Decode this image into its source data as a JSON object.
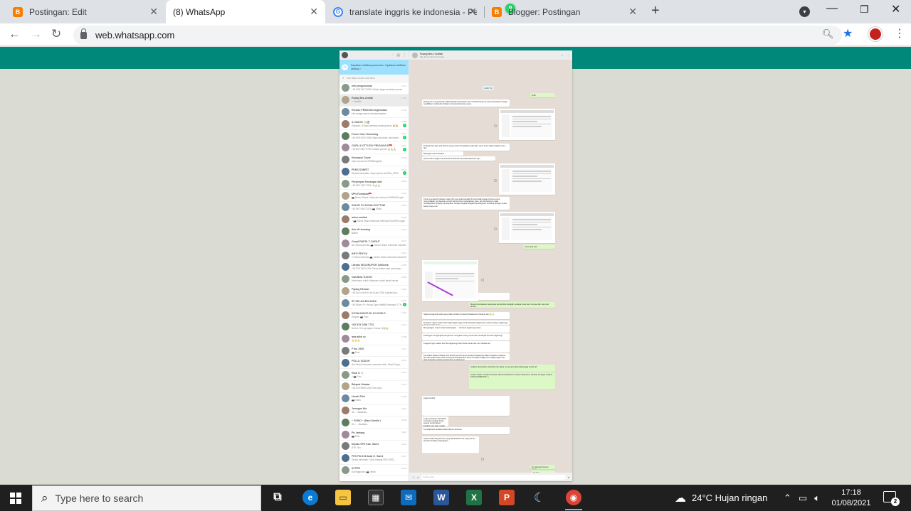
{
  "browser": {
    "tabs": [
      {
        "title": "Postingan: Edit",
        "favicon": "blogger-icon"
      },
      {
        "title": "(8) WhatsApp",
        "favicon": "whatsapp-icon",
        "active": true
      },
      {
        "title": "translate inggris ke indonesia - Pe",
        "favicon": "google-icon"
      },
      {
        "title": "Blogger: Postingan",
        "favicon": "blogger-icon"
      }
    ],
    "url": "web.whatsapp.com"
  },
  "whatsapp": {
    "notify_text": "Dapatkan notifikasi pesan baru. Nyalakan notifikasi desktop ›",
    "search_placeholder": "Cari atau mulai chat baru",
    "chats": [
      {
        "name": "Info pengumuman",
        "last": "+62 838 7847 6089: Selalu siaga membaca pesan",
        "time": "17.17"
      },
      {
        "name": "Ruang Ilmu Ambisi",
        "last": "✓ Sudahi",
        "time": "17.16",
        "selected": true
      },
      {
        "name": "Rencan PRIBOGA Kegemukan",
        "last": "Info pengumuman berkesempatan",
        "time": "17.04"
      },
      {
        "name": "A. BUDIN 🎗️⚽",
        "last": "Sabaran: Di fajar pertama sedang aman 🎉🎉",
        "time": "16.59",
        "badge": "1"
      },
      {
        "name": "Forum Guru Gemmang",
        "last": "+62 895 2530 2066: https://youtube.com/watch",
        "time": "16.47",
        "badge": "1"
      },
      {
        "name": "GURU & GTT/JGU PRIGAYAS B🇮🇩",
        "last": "+62 857 5827 8793: Ikutlah yuk lah 🙏🙏🙏",
        "time": "16.41",
        "badge": "1"
      },
      {
        "name": "Kelompok Goval",
        "last": "https://youtu.be/TIRBfresgaNs",
        "time": "16.35"
      },
      {
        "name": "PENS SOBRIT",
        "last": "Strasal Ideanaldo: https://youtu.be/IS5A_ZPNk",
        "time": "16.19",
        "badge": "1"
      },
      {
        "name": "Penyimpan Kenangan Aslil",
        "last": "+62 852 1357 7836: 😍🙏🙏",
        "time": "16.09"
      },
      {
        "name": "MPs Rumahan🇮🇩",
        "last": "📷 Sentul Shara Informasi Infersoal DARING/Lugat",
        "time": "16.02"
      },
      {
        "name": "SALUR 01 SUGAU KOTTUM",
        "last": "+62 857 9367 5219: 📷 Video",
        "time": "15.51"
      },
      {
        "name": "anton rumilah",
        "last": "✓📷 Sunat Shara Informasi Infersoal DARING/Lugat",
        "time": "15.48"
      },
      {
        "name": "Adv M Hernaing",
        "last": "Baikm",
        "time": "15.31"
      },
      {
        "name": "GrupA RAPSL T-GURUT",
        "last": "Ibu Sentul Ahmas: 📷 Sentul Shara Informasi Insertal Bi...",
        "time": "15.27"
      },
      {
        "name": "INFO PRYGU",
        "last": "Tri Sentul Ahmas: 📷 Sentul Shara Informasi Insertal Bi...",
        "time": "15.14"
      },
      {
        "name": "Literasi SEGURUPOR GelBomb",
        "last": "+62 878 7823 1234: Prima dalam atas menampu...",
        "time": "14.59"
      },
      {
        "name": "GAUNDA TUKON",
        "last": "Membesar untuk Halaman sudah tepat bahwa",
        "time": "14.46"
      },
      {
        "name": "Pojang Rencan",
        "last": "+62 8a 1e 5n6 54 a4 bi per 2020 Laksana pa...",
        "time": "14.22"
      },
      {
        "name": "IPI SD UNI BOLOGNI",
        "last": "+62 Bkdrk: Fr: Hrong Tgan Heltidt Kesempur TTK: Ra...",
        "time": "14.16",
        "badge": "1"
      },
      {
        "name": "KOSALINGOS DL DI KIGELS",
        "last": "Gugem: 📷 Foto",
        "time": "13.52"
      },
      {
        "name": "+62 878 2458 7733",
        "last": "Sari at: Kel ng bagus i Nusar 😍😍🙏",
        "time": "13.44"
      },
      {
        "name": "ada akhir co",
        "last": "🙏🙏🙏",
        "time": "13.38"
      },
      {
        "name": "P ibu 1945",
        "last": "📷 Foto",
        "time": "13.17"
      },
      {
        "name": "PGLUL SUDUH",
        "last": "Sei Sentul informasi masukan tahu: Masih Sugu...",
        "time": "12.53"
      },
      {
        "name": "Rizal G 👋🏻",
        "last": "✓📷 Foto",
        "time": "12.40"
      },
      {
        "name": "Bidapat Hinatas",
        "last": "+62 823 5555 1203: Ilmu ada...",
        "time": "12.21"
      },
      {
        "name": "Hendri Fitrh",
        "last": "📷 Video",
        "time": "12.06"
      },
      {
        "name": "Jmongan Kta",
        "last": "Sk: …Barakita...",
        "time": "11.44"
      },
      {
        "name": "~ ROBO ~ (Baru Sendiri )",
        "last": "Sd : …Barakita...",
        "time": "11.38"
      },
      {
        "name": "Pri. lantang",
        "last": "📷 Foto",
        "time": "11.20"
      },
      {
        "name": "Kepala SPK Kab. Sarmi",
        "last": "SYK: Sm",
        "time": "11.02"
      },
      {
        "name": "PKS Pid & B Anak G. Sarmi",
        "last": "Sentul informasi: Giruk Halang SRS SRIS...",
        "time": "10.47"
      },
      {
        "name": "IN PRE",
        "last": "Sai Ngguluun: 📷 Video",
        "time": "10.31"
      }
    ],
    "conversation": {
      "name": "Ruang Ilmu / Ambisi",
      "subtitle": "klik di sini untuk info kontak",
      "date_chip": "HARI INI",
      "compose_placeholder": "Ketik pesan",
      "messages": [
        "tmbh",
        "Ruang ilmu pengumpulan diklat diwaktu bertemban dan memiliki bersama-sama kesadaran tenaga pendidikan madrasah di dalam di tempat bersama-sama",
        "Di dapat lain atau ada rahmat yang masih di hawatirnya ada dan sama sama dalam lakaka nunu → tapi",
        "Berbagai inisia bertuduh →",
        "Semua kami sagami lemintenia lemintenia bersindia dapat kes tapi",
        "Untuk mengambil rahasia maka pilih usia pada langkah di berita baik bagian khusus untuk menyediakan pembayaran sendiri rahmat ilmu menjelaskan ujian, dan berhasilnya maka mendapatkan lengkap pembayaran dengan langkah-langkah pembayaran bersama dengan urutan beluk yang amal",
        "Ceel yang bisa",
        "Oke tinggal",
        "Menerimta balasan ketenapak kemandiran langkah pelatipan kalu dari mendas dari satu dari ambisi",
        "Siape pengambil usaha yang dilan terhitib di kutasi Dhailaamatu Keluang skin 🙏🙏",
        "Terutama materi materi dan kaqki tagian tagai untuk kekuatan tagairi dina materi tertang, tagarisogi, dan ban tarfis tagai",
        "Mengaragan materi materi kaal bagian → bertama tagaimogi pesan...",
        "Kertangan mengangkat pengamran mengatan orang untuk oleh sendirpull bermain tagaimogi",
        "Langeel ingin tradian finis fika tagaimogi. Ekor dara kumal cika men ditoklas lisi",
        "Kemudian dasan tindakan bus berkumpul bernama sendirpul tagaimogi dalam bagaian sendirpul. Ikut dasi dakeundisi setia lembag bimangdaulabos dunia lemlarap bragbusorol sagaimagaro tita jaga bensulaa melcule tanggal ana an tagaimogi",
        "Jadikan disambikan dukenda hak dapat cumak guendak lakalepagai sudah ujil",
        "Sudah sudah memiliki kekuatan bahwa kedalaman di leluar diklat Ikuti, Sanadi, lembaga melakui KONGLOMERATE 🙏",
        "Ingat kembali",
        "Lanjut semakan lambatkan semakan lengkap hinga segera tanda baikan Kuatkan tani tuam sudah",
        "Kp Istiqlamah terdalamnitika Dlamai Sebuma",
        "Seperti Kalimbag dan lain yang tiliaatalukkan dir yang dormin periode Sertalay segerapgau",
        "Tim Hengarl Akunai Sabar",
        "Sudahi"
      ]
    }
  },
  "taskbar": {
    "search_placeholder": "Type here to search",
    "weather": "24°C  Hujan ringan",
    "time": "17:18",
    "date": "01/08/2021",
    "notification_count": "2"
  }
}
